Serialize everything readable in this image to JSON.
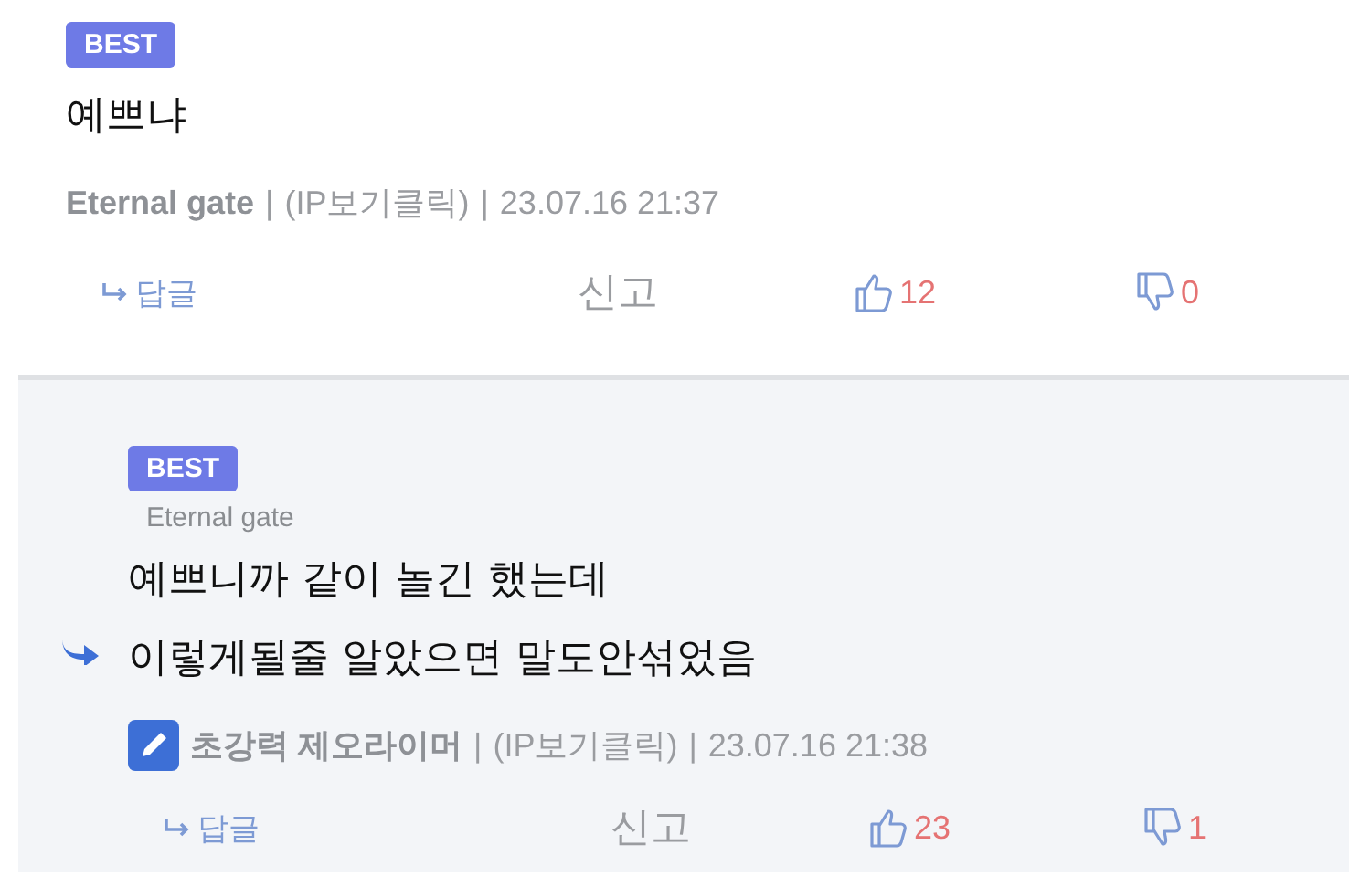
{
  "comments": [
    {
      "kind": "comment",
      "badge": "BEST",
      "lines": [
        "예쁘냐"
      ],
      "author": "Eternal gate",
      "separator": "|",
      "ip": "(IP보기클릭)",
      "date": "23.07.16 21:37",
      "reply_label": "답글",
      "report_label": "신고",
      "likes": "12",
      "dislikes": "0"
    },
    {
      "kind": "reply",
      "badge": "BEST",
      "reply_to": "Eternal gate",
      "lines": [
        "예쁘니까 같이 놀긴 했는데",
        "이렇게될줄 알았으면 말도안섞었음"
      ],
      "author": "초강력 제오라이머",
      "separator": "|",
      "ip": "(IP보기클릭)",
      "date": "23.07.16 21:38",
      "reply_label": "답글",
      "report_label": "신고",
      "likes": "23",
      "dislikes": "1"
    }
  ]
}
